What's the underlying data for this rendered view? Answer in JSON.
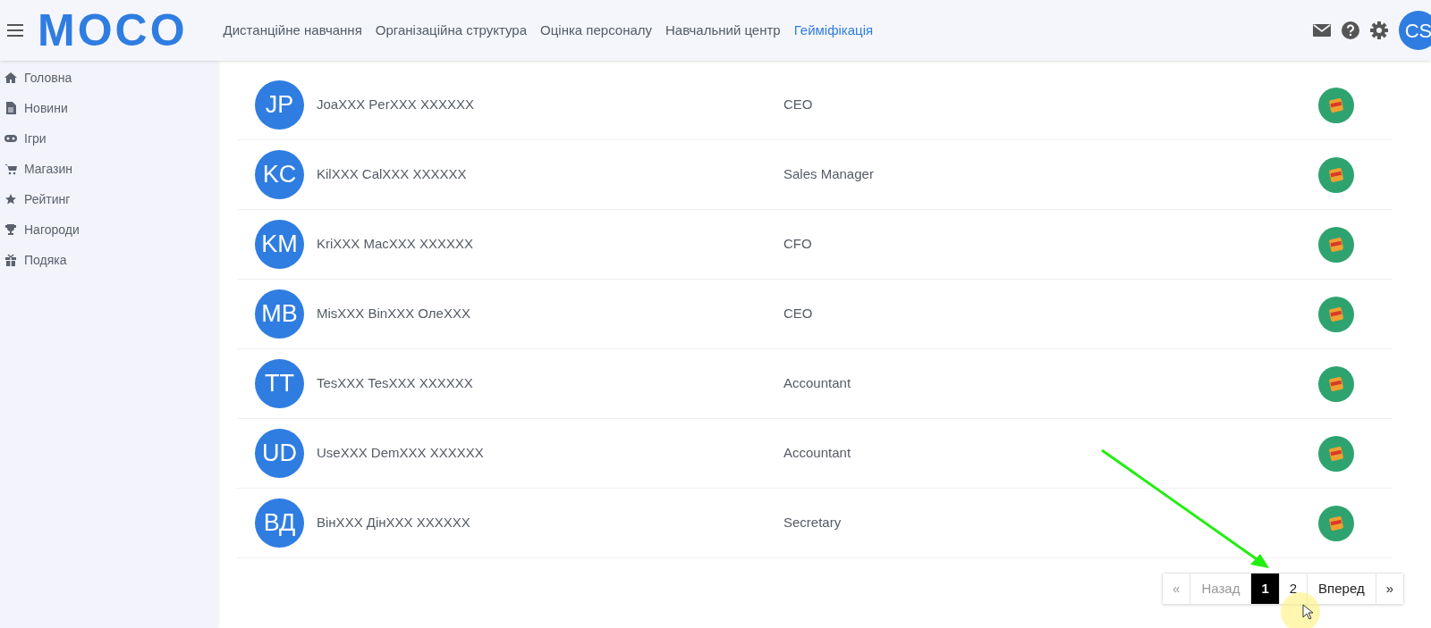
{
  "header": {
    "logo": "MOCO",
    "nav": [
      {
        "label": "Дистанційне навчання",
        "selected": false
      },
      {
        "label": "Організаційна структура",
        "selected": false
      },
      {
        "label": "Оцінка персоналу",
        "selected": false
      },
      {
        "label": "Навчальний центр",
        "selected": false
      },
      {
        "label": "Гейміфікація",
        "selected": true
      }
    ],
    "user_initials": "CS"
  },
  "sidebar": {
    "items": [
      {
        "label": "Головна"
      },
      {
        "label": "Новини"
      },
      {
        "label": "Ігри"
      },
      {
        "label": "Магазин"
      },
      {
        "label": "Рейтинг"
      },
      {
        "label": "Нагороди"
      },
      {
        "label": "Подяка"
      }
    ]
  },
  "rows": [
    {
      "initials": "JP",
      "name": "JoaXXX PerXXX XXXXXX",
      "position": "CEO"
    },
    {
      "initials": "KC",
      "name": "KilXXX CalXXX XXXXXX",
      "position": "Sales Manager"
    },
    {
      "initials": "KM",
      "name": "KriXXX MacXXX XXXXXX",
      "position": "CFO"
    },
    {
      "initials": "MB",
      "name": "MisXXX BinXXX ОлеXXX",
      "position": "CEO"
    },
    {
      "initials": "TT",
      "name": "TesXXX TesXXX XXXXXX",
      "position": "Accountant"
    },
    {
      "initials": "UD",
      "name": "UseXXX DemXXX XXXXXX",
      "position": "Accountant"
    },
    {
      "initials": "ВД",
      "name": "ВінXXX ДінXXX XXXXXX",
      "position": "Secretary"
    }
  ],
  "pagination": [
    {
      "label": "«",
      "disabled": true,
      "selected": false
    },
    {
      "label": "Назад",
      "disabled": true,
      "selected": false
    },
    {
      "label": "1",
      "disabled": false,
      "selected": true
    },
    {
      "label": "2",
      "disabled": false,
      "selected": false
    },
    {
      "label": "Вперед",
      "disabled": false,
      "selected": false
    },
    {
      "label": "»",
      "disabled": false,
      "selected": false
    }
  ]
}
